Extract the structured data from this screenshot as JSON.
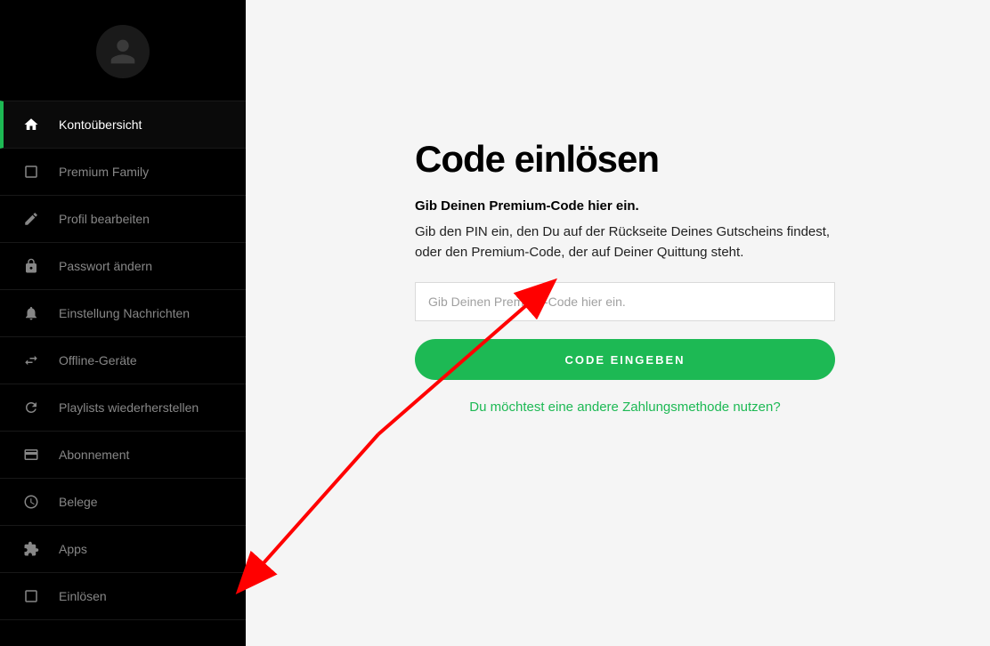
{
  "sidebar": {
    "items": [
      {
        "label": "Kontoübersicht",
        "icon": "home-icon",
        "active": true
      },
      {
        "label": "Premium Family",
        "icon": "family-icon",
        "active": false
      },
      {
        "label": "Profil bearbeiten",
        "icon": "pencil-icon",
        "active": false
      },
      {
        "label": "Passwort ändern",
        "icon": "lock-icon",
        "active": false
      },
      {
        "label": "Einstellung Nachrichten",
        "icon": "bell-icon",
        "active": false
      },
      {
        "label": "Offline-Geräte",
        "icon": "offline-icon",
        "active": false
      },
      {
        "label": "Playlists wiederherstellen",
        "icon": "restore-icon",
        "active": false
      },
      {
        "label": "Abonnement",
        "icon": "card-icon",
        "active": false
      },
      {
        "label": "Belege",
        "icon": "clock-icon",
        "active": false
      },
      {
        "label": "Apps",
        "icon": "puzzle-icon",
        "active": false
      },
      {
        "label": "Einlösen",
        "icon": "redeem-icon",
        "active": false
      }
    ]
  },
  "main": {
    "title": "Code einlösen",
    "subtitle": "Gib Deinen Premium-Code hier ein.",
    "description": "Gib den PIN ein, den Du auf der Rückseite Deines Gutscheins findest, oder den Premium-Code, der auf Deiner Quittung steht.",
    "input_placeholder": "Gib Deinen Premium-Code hier ein.",
    "submit_label": "CODE EINGEBEN",
    "alt_payment_label": "Du möchtest eine andere Zahlungsmethode nutzen?"
  },
  "colors": {
    "accent": "#1db954"
  }
}
